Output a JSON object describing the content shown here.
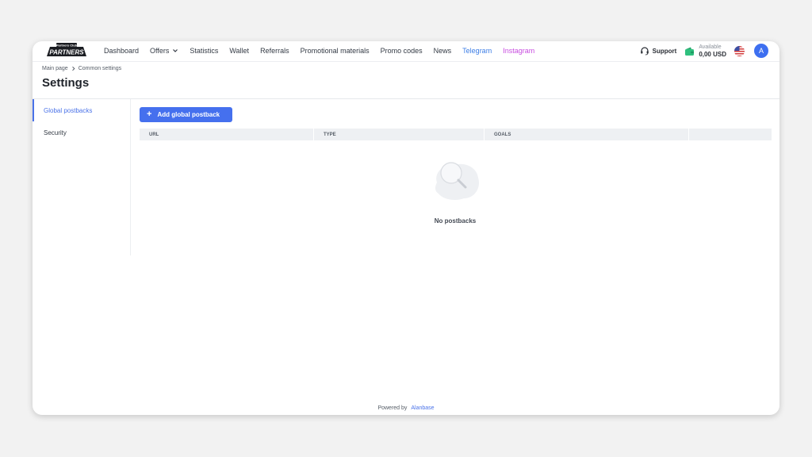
{
  "brand": {
    "logo_top": "Partners Club",
    "logo_text": "PARTNERS"
  },
  "nav": {
    "items": [
      {
        "label": "Dashboard"
      },
      {
        "label": "Offers"
      },
      {
        "label": "Statistics"
      },
      {
        "label": "Wallet"
      },
      {
        "label": "Referrals"
      },
      {
        "label": "Promotional materials"
      },
      {
        "label": "Promo codes"
      },
      {
        "label": "News"
      },
      {
        "label": "Telegram",
        "color": "#3d7ee6"
      },
      {
        "label": "Instagram",
        "color": "#c84de0"
      }
    ]
  },
  "header_right": {
    "support_label": "Support",
    "wallet_label": "Available",
    "wallet_amount": "0,00 USD",
    "avatar_initial": "A",
    "wallet_icon_color": "#2fc07e"
  },
  "breadcrumb": {
    "home": "Main page",
    "current": "Common settings"
  },
  "page": {
    "title": "Settings"
  },
  "sidebar": {
    "items": [
      {
        "label": "Global postbacks"
      },
      {
        "label": "Security"
      }
    ]
  },
  "main": {
    "add_button": "Add global postback",
    "table": {
      "headers": [
        "URL",
        "TYPE",
        "GOALS"
      ]
    },
    "empty_text": "No postbacks"
  },
  "footer": {
    "powered_by": "Powered by",
    "brand": "Alanbase"
  },
  "colors": {
    "accent": "#4570ee",
    "telegram": "#3d7ee6",
    "instagram": "#c84de0"
  }
}
